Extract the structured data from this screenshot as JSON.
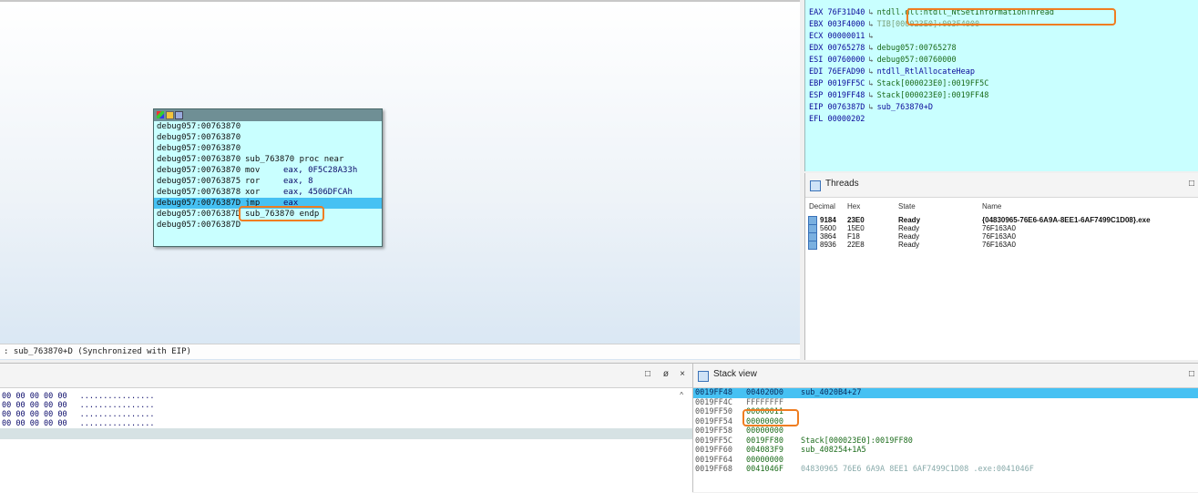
{
  "graph": {
    "status_text": ": sub_763870+D (Synchronized with EIP)",
    "node": {
      "lines": [
        {
          "addr": "debug057:00763870",
          "mnemonic": "",
          "operand": ""
        },
        {
          "addr": "debug057:00763870",
          "mnemonic": "",
          "operand": ""
        },
        {
          "addr": "debug057:00763870",
          "mnemonic": "",
          "operand": ""
        },
        {
          "addr": "debug057:00763870",
          "mnemonic": "sub_763870 proc near",
          "operand": ""
        },
        {
          "addr": "debug057:00763870",
          "mnemonic": "mov",
          "operand": "eax, 0F5C28A33h"
        },
        {
          "addr": "debug057:00763875",
          "mnemonic": "ror",
          "operand": "eax, 8"
        },
        {
          "addr": "debug057:00763878",
          "mnemonic": "xor",
          "operand": "eax, 4506DFCAh"
        },
        {
          "addr": "debug057:0076387D",
          "mnemonic": "jmp",
          "operand": "eax"
        },
        {
          "addr": "debug057:0076387D",
          "mnemonic": "sub_763870 endp",
          "operand": ""
        },
        {
          "addr": "debug057:0076387D",
          "mnemonic": "",
          "operand": ""
        }
      ]
    }
  },
  "registers": [
    {
      "name": "EAX",
      "value": "76F31D40",
      "target": "ntdll.dll:ntdll_NtSetInformationThread"
    },
    {
      "name": "EBX",
      "value": "003F4000",
      "target": "TIB[000023E0]:003F4000"
    },
    {
      "name": "ECX",
      "value": "00000011",
      "target": ""
    },
    {
      "name": "EDX",
      "value": "00765278",
      "target": "debug057:00765278"
    },
    {
      "name": "ESI",
      "value": "00760000",
      "target": "debug057:00760000"
    },
    {
      "name": "EDI",
      "value": "76EFAD90",
      "target": "ntdll_RtlAllocateHeap"
    },
    {
      "name": "EBP",
      "value": "0019FF5C",
      "target": "Stack[000023E0]:0019FF5C"
    },
    {
      "name": "ESP",
      "value": "0019FF48",
      "target": "Stack[000023E0]:0019FF48"
    },
    {
      "name": "EIP",
      "value": "0076387D",
      "target": "sub_763870+D"
    },
    {
      "name": "EFL",
      "value": "00000202",
      "target": ""
    }
  ],
  "threads": {
    "title": "Threads",
    "columns": [
      "Decimal",
      "Hex",
      "State",
      "Name"
    ],
    "rows": [
      {
        "decimal": "9184",
        "hex": "23E0",
        "state": "Ready",
        "name": "{04830965-76E6-6A9A-8EE1-6AF7499C1D08}.exe"
      },
      {
        "decimal": "5600",
        "hex": "15E0",
        "state": "Ready",
        "name": "76F163A0"
      },
      {
        "decimal": "3864",
        "hex": "F18",
        "state": "Ready",
        "name": "76F163A0"
      },
      {
        "decimal": "8936",
        "hex": "22E8",
        "state": "Ready",
        "name": "76F163A0"
      }
    ]
  },
  "hex_view": {
    "rows": [
      {
        "bytes": "00 00 00 00 00",
        "ascii": "................"
      },
      {
        "bytes": "00 00 00 00 00",
        "ascii": "................"
      },
      {
        "bytes": "00 00 00 00 00",
        "ascii": "................"
      },
      {
        "bytes": "00 00 00 00 00",
        "ascii": "................"
      }
    ]
  },
  "stack_view": {
    "title": "Stack view",
    "rows": [
      {
        "addr": "0019FF48",
        "value": "004020D0",
        "comment": "sub_4020B4+27"
      },
      {
        "addr": "0019FF4C",
        "value": "FFFFFFFF",
        "comment": ""
      },
      {
        "addr": "0019FF50",
        "value": "00000011",
        "comment": ""
      },
      {
        "addr": "0019FF54",
        "value": "00000000",
        "comment": ""
      },
      {
        "addr": "0019FF58",
        "value": "00000000",
        "comment": ""
      },
      {
        "addr": "0019FF5C",
        "value": "0019FF80",
        "comment": "Stack[000023E0]:0019FF80"
      },
      {
        "addr": "0019FF60",
        "value": "004083F9",
        "comment": "sub_408254+1A5"
      },
      {
        "addr": "0019FF64",
        "value": "00000000",
        "comment": ""
      },
      {
        "addr": "0019FF68",
        "value": "0041046F",
        "comment": "04830965 76E6 6A9A 8EE1 6AF7499C1D08 .exe:0041046F"
      }
    ]
  },
  "pane_buttons": {
    "restore": "□",
    "float": "ø",
    "close": "×",
    "restore2": "□"
  },
  "icons": {
    "scroll_up": "^"
  },
  "colors": {
    "highlight_box": "#ef7d21",
    "selection": "#46c1f3",
    "panel_cyan": "#c9ffff"
  }
}
